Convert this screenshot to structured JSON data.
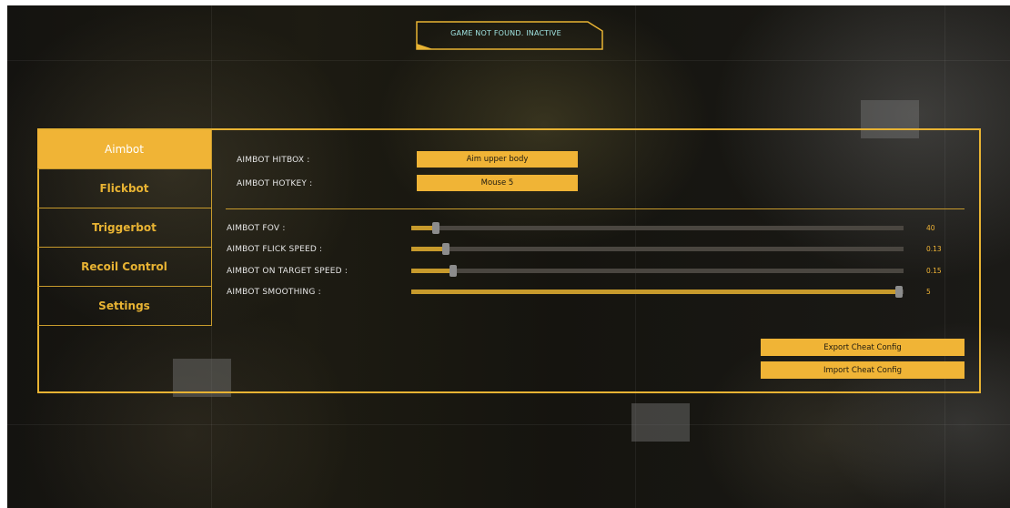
{
  "status": {
    "text": "GAME NOT FOUND. INACTIVE"
  },
  "sidebar": {
    "tabs": [
      {
        "label": "Aimbot",
        "active": true
      },
      {
        "label": "Flickbot",
        "active": false
      },
      {
        "label": "Triggerbot",
        "active": false
      },
      {
        "label": "Recoil Control",
        "active": false
      },
      {
        "label": "Settings",
        "active": false
      }
    ]
  },
  "aimbot": {
    "hitbox": {
      "label": "AIMBOT HITBOX :",
      "value": "Aim upper body"
    },
    "hotkey": {
      "label": "AIMBOT HOTKEY :",
      "value": "Mouse 5"
    },
    "sliders": [
      {
        "label": "AIMBOT FOV :",
        "value": "40",
        "fraction": 0.05
      },
      {
        "label": "AIMBOT FLICK SPEED :",
        "value": "0.13",
        "fraction": 0.07
      },
      {
        "label": "AIMBOT ON TARGET SPEED :",
        "value": "0.15",
        "fraction": 0.085
      },
      {
        "label": "AIMBOT SMOOTHING :",
        "value": "5",
        "fraction": 0.99
      }
    ]
  },
  "config": {
    "export_label": "Export Cheat Config",
    "import_label": "Import Cheat Config"
  },
  "colors": {
    "accent": "#f0b436",
    "status_text": "#9fe3e0"
  }
}
